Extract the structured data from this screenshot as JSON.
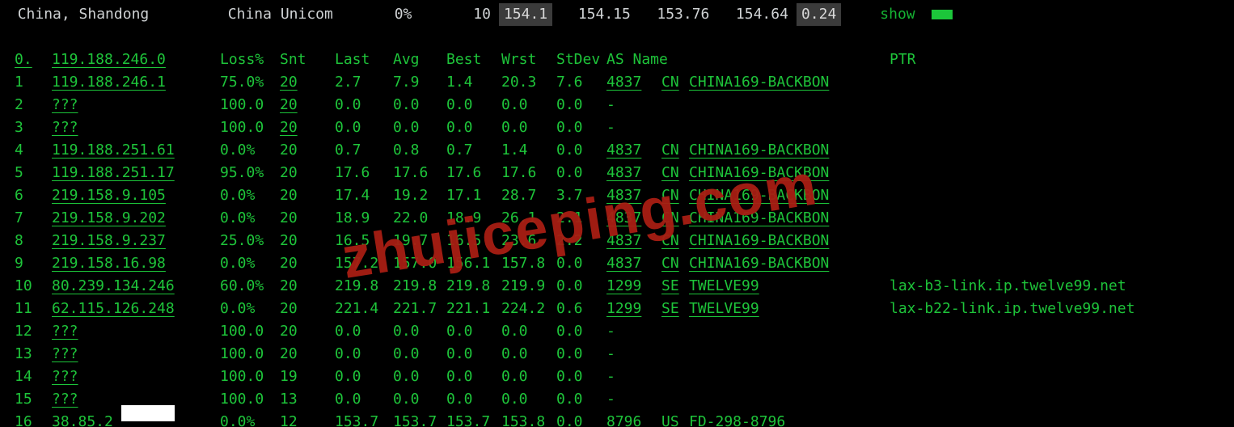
{
  "top": {
    "location": "China, Shandong",
    "isp": "China Unicom",
    "pct": "0%",
    "count": "10",
    "v1": "154.1",
    "v2": "154.15",
    "v3": "153.76",
    "v4": "154.64",
    "v5": "0.24",
    "show": "show"
  },
  "headers": {
    "n": "0.",
    "ip": "119.188.246.0",
    "loss": "Loss%",
    "snt": "Snt",
    "last": "Last",
    "avg": "Avg",
    "best": "Best",
    "wrst": "Wrst",
    "stdev": "StDev",
    "asname": "AS Name",
    "ptr": "PTR"
  },
  "hops": [
    {
      "n": "1",
      "ip": "119.188.246.1",
      "loss": "75.0%",
      "snt": "20",
      "last": "2.7",
      "avg": "7.9",
      "best": "1.4",
      "wrst": "20.3",
      "stdev": "7.6",
      "asn": "4837",
      "cc": "CN",
      "asname": "CHINA169-BACKBON",
      "ptr": ""
    },
    {
      "n": "2",
      "ip": "???",
      "loss": "100.0",
      "snt": "20",
      "last": "0.0",
      "avg": "0.0",
      "best": "0.0",
      "wrst": "0.0",
      "stdev": "0.0",
      "asn": "-",
      "cc": "",
      "asname": "",
      "ptr": ""
    },
    {
      "n": "3",
      "ip": "???",
      "loss": "100.0",
      "snt": "20",
      "last": "0.0",
      "avg": "0.0",
      "best": "0.0",
      "wrst": "0.0",
      "stdev": "0.0",
      "asn": "-",
      "cc": "",
      "asname": "",
      "ptr": ""
    },
    {
      "n": "4",
      "ip": "119.188.251.61",
      "loss": "0.0%",
      "snt": "20",
      "last": "0.7",
      "avg": "0.8",
      "best": "0.7",
      "wrst": "1.4",
      "stdev": "0.0",
      "asn": "4837",
      "cc": "CN",
      "asname": "CHINA169-BACKBON",
      "ptr": ""
    },
    {
      "n": "5",
      "ip": "119.188.251.17",
      "loss": "95.0%",
      "snt": "20",
      "last": "17.6",
      "avg": "17.6",
      "best": "17.6",
      "wrst": "17.6",
      "stdev": "0.0",
      "asn": "4837",
      "cc": "CN",
      "asname": "CHINA169-BACKBON",
      "ptr": ""
    },
    {
      "n": "6",
      "ip": "219.158.9.105",
      "loss": "0.0%",
      "snt": "20",
      "last": "17.4",
      "avg": "19.2",
      "best": "17.1",
      "wrst": "28.7",
      "stdev": "3.7",
      "asn": "4837",
      "cc": "CN",
      "asname": "CHINA169-BACKBON",
      "ptr": ""
    },
    {
      "n": "7",
      "ip": "219.158.9.202",
      "loss": "0.0%",
      "snt": "20",
      "last": "18.9",
      "avg": "22.0",
      "best": "18.9",
      "wrst": "26.1",
      "stdev": "2.1",
      "asn": "4837",
      "cc": "CN",
      "asname": "CHINA169-BACKBON",
      "ptr": ""
    },
    {
      "n": "8",
      "ip": "219.158.9.237",
      "loss": "25.0%",
      "snt": "20",
      "last": "16.5",
      "avg": "19.7",
      "best": "16.5",
      "wrst": "23.6",
      "stdev": "2.2",
      "asn": "4837",
      "cc": "CN",
      "asname": "CHINA169-BACKBON",
      "ptr": ""
    },
    {
      "n": "9",
      "ip": "219.158.16.98",
      "loss": "0.0%",
      "snt": "20",
      "last": "157.2",
      "avg": "157.0",
      "best": "156.1",
      "wrst": "157.8",
      "stdev": "0.0",
      "asn": "4837",
      "cc": "CN",
      "asname": "CHINA169-BACKBON",
      "ptr": ""
    },
    {
      "n": "10",
      "ip": "80.239.134.246",
      "loss": "60.0%",
      "snt": "20",
      "last": "219.8",
      "avg": "219.8",
      "best": "219.8",
      "wrst": "219.9",
      "stdev": "0.0",
      "asn": "1299",
      "cc": "SE",
      "asname": "TWELVE99",
      "ptr": "lax-b3-link.ip.twelve99.net"
    },
    {
      "n": "11",
      "ip": "62.115.126.248",
      "loss": "0.0%",
      "snt": "20",
      "last": "221.4",
      "avg": "221.7",
      "best": "221.1",
      "wrst": "224.2",
      "stdev": "0.6",
      "asn": "1299",
      "cc": "SE",
      "asname": "TWELVE99",
      "ptr": "lax-b22-link.ip.twelve99.net"
    },
    {
      "n": "12",
      "ip": "???",
      "loss": "100.0",
      "snt": "20",
      "last": "0.0",
      "avg": "0.0",
      "best": "0.0",
      "wrst": "0.0",
      "stdev": "0.0",
      "asn": "-",
      "cc": "",
      "asname": "",
      "ptr": ""
    },
    {
      "n": "13",
      "ip": "???",
      "loss": "100.0",
      "snt": "20",
      "last": "0.0",
      "avg": "0.0",
      "best": "0.0",
      "wrst": "0.0",
      "stdev": "0.0",
      "asn": "-",
      "cc": "",
      "asname": "",
      "ptr": ""
    },
    {
      "n": "14",
      "ip": "???",
      "loss": "100.0",
      "snt": "19",
      "last": "0.0",
      "avg": "0.0",
      "best": "0.0",
      "wrst": "0.0",
      "stdev": "0.0",
      "asn": "-",
      "cc": "",
      "asname": "",
      "ptr": ""
    },
    {
      "n": "15",
      "ip": "???",
      "loss": "100.0",
      "snt": "13",
      "last": "0.0",
      "avg": "0.0",
      "best": "0.0",
      "wrst": "0.0",
      "stdev": "0.0",
      "asn": "-",
      "cc": "",
      "asname": "",
      "ptr": ""
    },
    {
      "n": "16",
      "ip": "38.85.2",
      "loss": "0.0%",
      "snt": "12",
      "last": "153.7",
      "avg": "153.7",
      "best": "153.7",
      "wrst": "153.8",
      "stdev": "0.0",
      "asn": "8796",
      "cc": "US",
      "asname": "FD-298-8796",
      "ptr": ""
    }
  ],
  "watermark": "zhujiceping.com"
}
